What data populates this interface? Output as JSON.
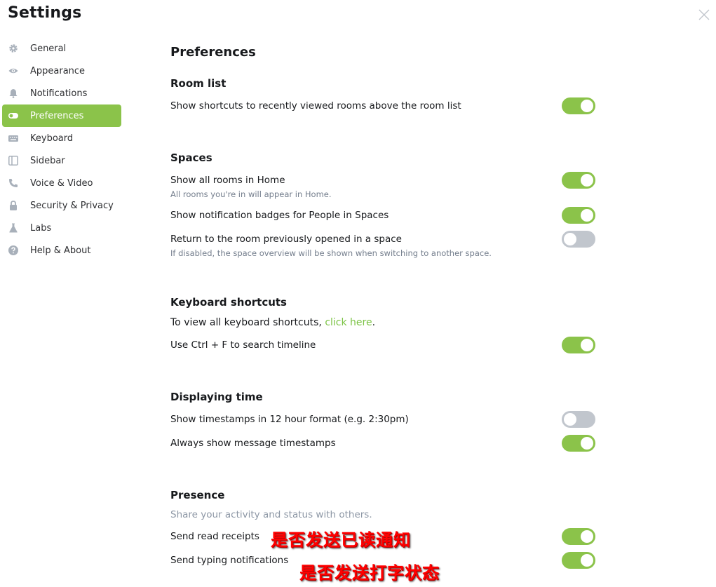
{
  "window": {
    "title": "Settings"
  },
  "sidebar": {
    "items": [
      {
        "label": "General",
        "icon": "gear-icon",
        "active": false
      },
      {
        "label": "Appearance",
        "icon": "eye-icon",
        "active": false
      },
      {
        "label": "Notifications",
        "icon": "bell-icon",
        "active": false
      },
      {
        "label": "Preferences",
        "icon": "toggle-icon",
        "active": true
      },
      {
        "label": "Keyboard",
        "icon": "keyboard-icon",
        "active": false
      },
      {
        "label": "Sidebar",
        "icon": "sidebar-icon",
        "active": false
      },
      {
        "label": "Voice & Video",
        "icon": "phone-icon",
        "active": false
      },
      {
        "label": "Security & Privacy",
        "icon": "lock-icon",
        "active": false
      },
      {
        "label": "Labs",
        "icon": "flask-icon",
        "active": false
      },
      {
        "label": "Help & About",
        "icon": "help-icon",
        "active": false
      }
    ]
  },
  "main": {
    "heading": "Preferences",
    "room_list": {
      "title": "Room list",
      "shortcuts": {
        "label": "Show shortcuts to recently viewed rooms above the room list",
        "on": true
      }
    },
    "spaces": {
      "title": "Spaces",
      "all_rooms": {
        "label": "Show all rooms in Home",
        "desc": "All rooms you're in will appear in Home.",
        "on": true
      },
      "badges": {
        "label": "Show notification badges for People in Spaces",
        "on": true
      },
      "return_room": {
        "label": "Return to the room previously opened in a space",
        "desc": "If disabled, the space overview will be shown when switching to another space.",
        "on": false
      }
    },
    "keyboard": {
      "title": "Keyboard shortcuts",
      "info_prefix": "To view all keyboard shortcuts, ",
      "info_link": "click here",
      "info_suffix": ".",
      "ctrl_f": {
        "label": "Use Ctrl + F to search timeline",
        "on": true
      }
    },
    "time": {
      "title": "Displaying time",
      "twelve_hour": {
        "label": "Show timestamps in 12 hour format (e.g. 2:30pm)",
        "on": false
      },
      "always_show": {
        "label": "Always show message timestamps",
        "on": true
      }
    },
    "presence": {
      "title": "Presence",
      "desc": "Share your activity and status with others.",
      "read_receipts": {
        "label": "Send read receipts",
        "on": true
      },
      "typing": {
        "label": "Send typing notifications",
        "on": true
      }
    }
  },
  "annotations": {
    "read_receipts_note": "是否发送已读通知",
    "typing_note": "是否发送打字状态"
  },
  "colors": {
    "accent": "#8bc34a",
    "toggle_off": "#c1c6cd",
    "link": "#7cc346",
    "annotation": "#ff0000"
  }
}
